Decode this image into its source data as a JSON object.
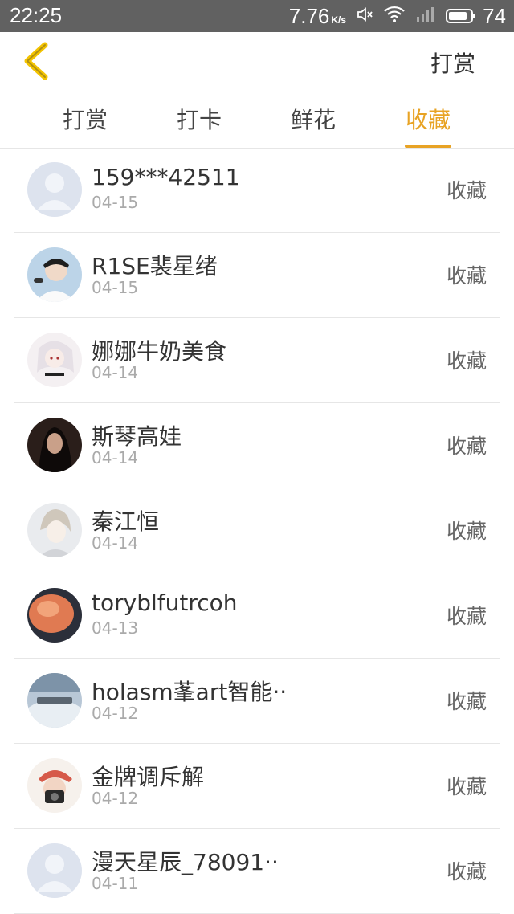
{
  "statusbar": {
    "time": "22:25",
    "speed": "7.76",
    "speed_unit": "K/s",
    "battery": "74"
  },
  "header": {
    "back_icon": "chevron-left-icon",
    "action_label": "打赏"
  },
  "tabs": [
    {
      "label": "打赏",
      "active": false
    },
    {
      "label": "打卡",
      "active": false
    },
    {
      "label": "鲜花",
      "active": false
    },
    {
      "label": "收藏",
      "active": true
    }
  ],
  "accent_color": "#e8a324",
  "list": [
    {
      "name": "159***42511",
      "date": "04-15",
      "action": "收藏"
    },
    {
      "name": "R1SE裴星绪",
      "date": "04-15",
      "action": "收藏"
    },
    {
      "name": "娜娜牛奶美食",
      "date": "04-14",
      "action": "收藏"
    },
    {
      "name": "斯琴高娃",
      "date": "04-14",
      "action": "收藏"
    },
    {
      "name": "秦江恒",
      "date": "04-14",
      "action": "收藏"
    },
    {
      "name": "toryblfutrcoh",
      "date": "04-13",
      "action": "收藏"
    },
    {
      "name": "holasm莑art智能··",
      "date": "04-12",
      "action": "收藏"
    },
    {
      "name": "金牌调斥解",
      "date": "04-12",
      "action": "收藏"
    },
    {
      "name": "漫天星辰_78091··",
      "date": "04-11",
      "action": "收藏"
    }
  ]
}
